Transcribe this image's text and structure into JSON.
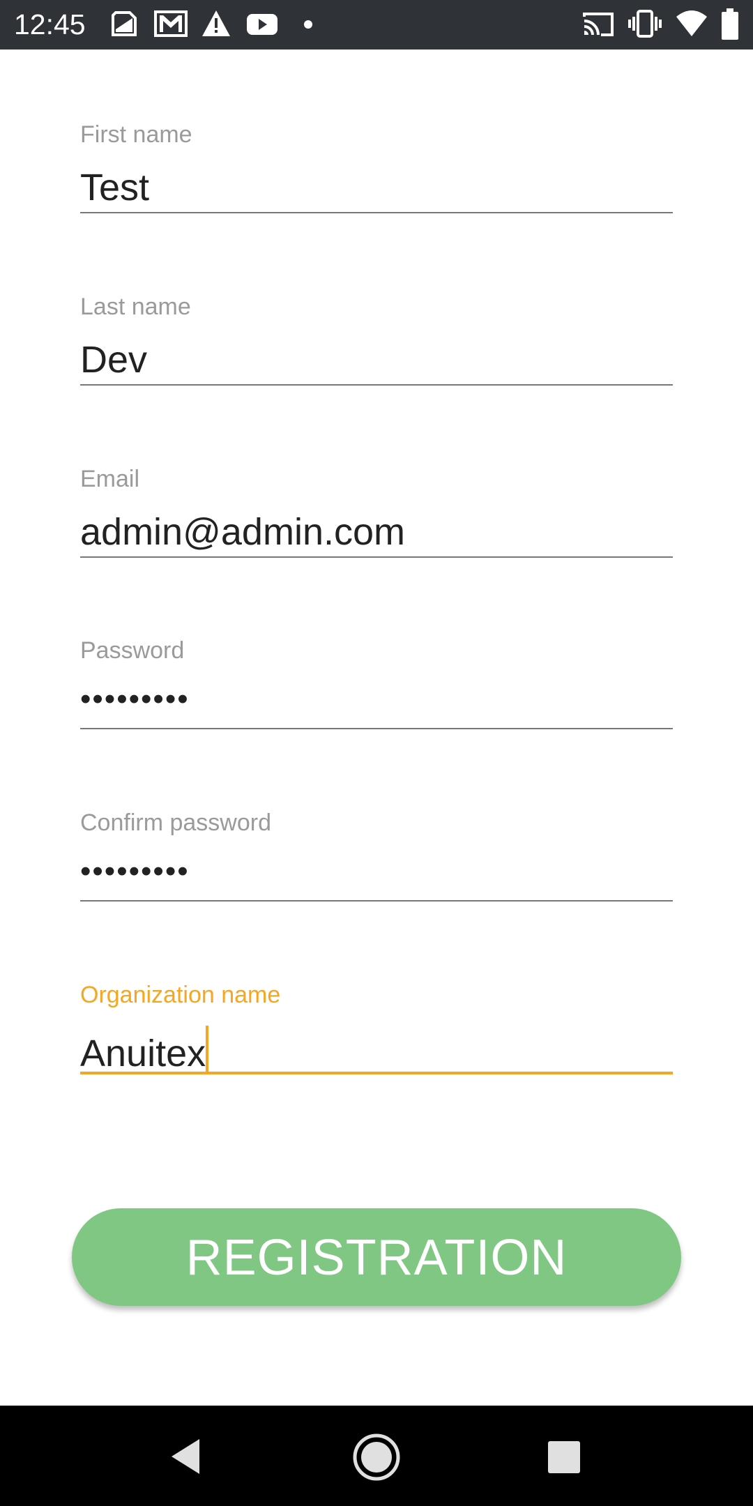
{
  "status_bar": {
    "time": "12:45",
    "notification_icons": [
      "sim-card-icon",
      "gmail-icon",
      "warning-icon",
      "youtube-icon",
      "dot-icon"
    ],
    "system_icons": [
      "cast-icon",
      "vibrate-icon",
      "wifi-icon",
      "battery-icon"
    ]
  },
  "form": {
    "first_name": {
      "label": "First name",
      "value": "Test"
    },
    "last_name": {
      "label": "Last name",
      "value": "Dev"
    },
    "email": {
      "label": "Email",
      "value": "admin@admin.com"
    },
    "password": {
      "label": "Password",
      "value": "•••••••••"
    },
    "confirm_password": {
      "label": "Confirm password",
      "value": "•••••••••"
    },
    "organization_name": {
      "label": "Organization name",
      "value": "Anuitex",
      "focused": true
    }
  },
  "registration_button": {
    "label": "REGISTRATION"
  },
  "colors": {
    "accent": "#f5a623",
    "button": "#81c784",
    "status_bar": "#2f3338",
    "nav_bar": "#000000"
  },
  "nav_bar": {
    "buttons": [
      "back-icon",
      "home-icon",
      "recents-icon"
    ]
  }
}
